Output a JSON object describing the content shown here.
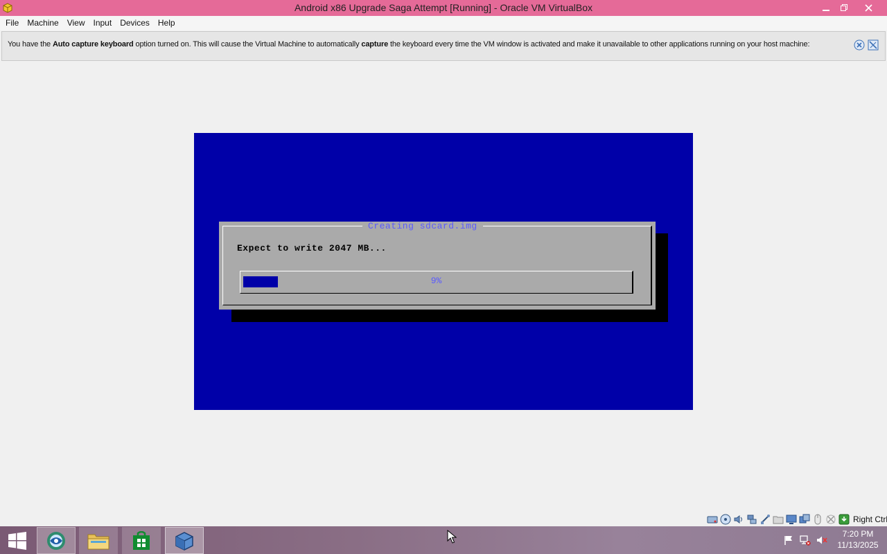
{
  "window": {
    "title": "Android x86 Upgrade Saga Attempt [Running] - Oracle VM VirtualBox"
  },
  "menu": {
    "items": [
      "File",
      "Machine",
      "View",
      "Input",
      "Devices",
      "Help"
    ]
  },
  "notice": {
    "part1": "You have the ",
    "bold1": "Auto capture keyboard",
    "part2": " option turned on. This will cause the Virtual Machine to automatically ",
    "bold2": "capture",
    "part3": " the keyboard every time the VM window is activated and make it unavailable to other applications running on your host machine:"
  },
  "vm": {
    "dialog_title": "Creating sdcard.img",
    "message": "Expect to write 2047 MB...",
    "progress_label": "9%",
    "progress_fraction": 0.09
  },
  "statusbar": {
    "host_key": "Right Ctrl",
    "icons": [
      "hard-disk-icon",
      "optical-drive-icon",
      "audio-icon",
      "network-icon",
      "usb-icon",
      "shared-folders-icon",
      "display-icon",
      "video-capture-icon",
      "mouse-integration-icon",
      "keyboard-capture-icon"
    ]
  },
  "taskbar": {
    "items": [
      "start-icon",
      "browser-icon",
      "file-explorer-icon",
      "store-icon",
      "virtualbox-icon"
    ]
  },
  "tray": {
    "time": "7:20 PM",
    "date": "11/13/2025"
  },
  "colors": {
    "titlebar": "#e56a98",
    "vm_background": "#0000a8",
    "dialog_background": "#aaaaaa",
    "dialog_title_text": "#5a5aff"
  }
}
